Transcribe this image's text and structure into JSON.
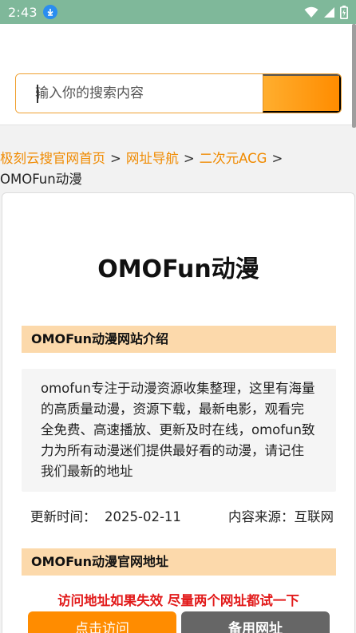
{
  "status": {
    "time": "2:43"
  },
  "search": {
    "placeholder": "输入你的搜索内容"
  },
  "breadcrumb": {
    "items": [
      "极刻云搜官网首页",
      "网址导航",
      "二次元ACG"
    ],
    "separator": ">",
    "current": "OMOFun动漫"
  },
  "main": {
    "title": "OMOFun动漫",
    "intro_heading": "OMOFun动漫网站介绍",
    "intro_text": "omofun专注于动漫资源收集整理，这里有海量的高质量动漫，资源下载，最新电影，观看完全免费、高速播放、更新及时在线，omofun致力为所有动漫迷们提供最好看的动漫，请记住我们最新的地址",
    "update_label": "更新时间：",
    "update_date": "2025-02-11",
    "source_label": "内容来源：",
    "source_value": "互联网",
    "url_heading": "OMOFun动漫官网地址",
    "warning": "访问地址如果失效 尽量两个网址都试一下",
    "visit_button": "点击访问",
    "backup_button": "备用网址"
  },
  "colors": {
    "accent": "#ff8c00",
    "section_bg": "#fcd9ab",
    "warning": "#e21b1b",
    "status_bar": "#7fb89a"
  }
}
